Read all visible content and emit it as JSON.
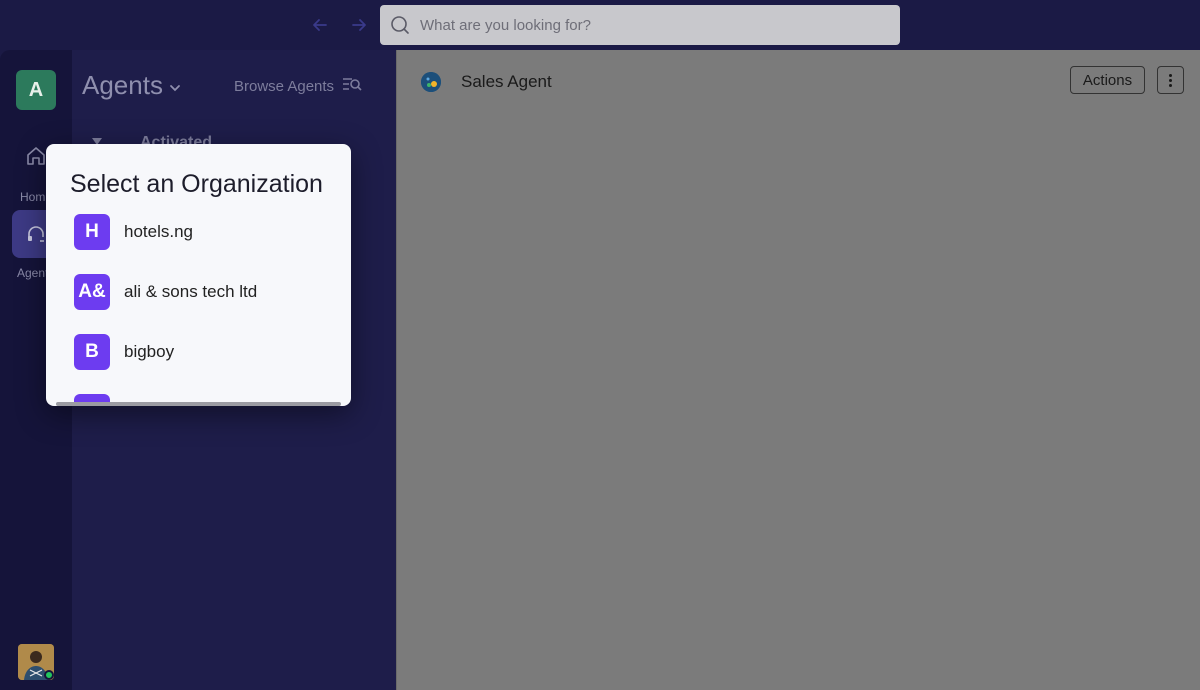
{
  "search": {
    "placeholder": "What are you looking for?"
  },
  "rail": {
    "org_initial": "A",
    "home_label": "Hom",
    "agents_label": "Agent"
  },
  "agents_panel": {
    "title": "Agents",
    "browse_label": "Browse Agents",
    "section_label": "Activated"
  },
  "main": {
    "agent_name": "Sales Agent",
    "actions_label": "Actions"
  },
  "modal": {
    "title": "Select an Organization",
    "organizations": [
      {
        "initials": "H",
        "name": "hotels.ng"
      },
      {
        "initials": "A&",
        "name": "ali & sons tech ltd"
      },
      {
        "initials": "B",
        "name": "bigboy"
      }
    ]
  },
  "colors": {
    "background": "#1b1a45",
    "accent": "#6d3cf0",
    "org_avatar": "#2c7a5c",
    "online": "#22c55e"
  }
}
